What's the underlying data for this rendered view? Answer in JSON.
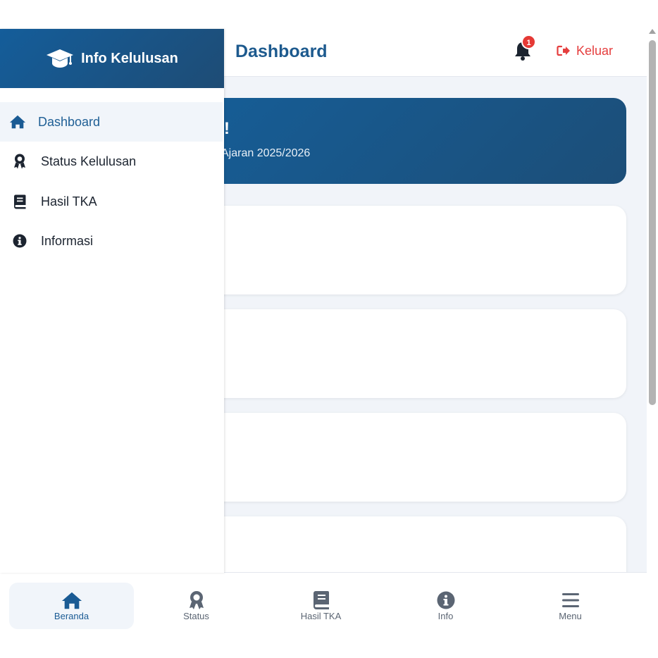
{
  "header": {
    "page_title": "Dashboard",
    "notification_count": "1",
    "logout_label": "Keluar"
  },
  "welcome": {
    "title_visible": "!",
    "subtitle_visible": "Ajaran 2025/2026"
  },
  "sidebar": {
    "brand": "Info Kelulusan",
    "items": [
      {
        "label": "Dashboard",
        "icon": "home-icon",
        "active": true
      },
      {
        "label": "Status Kelulusan",
        "icon": "award-icon",
        "active": false
      },
      {
        "label": "Hasil TKA",
        "icon": "book-icon",
        "active": false
      },
      {
        "label": "Informasi",
        "icon": "info-icon",
        "active": false
      }
    ]
  },
  "bottom_nav": {
    "items": [
      {
        "label": "Beranda",
        "icon": "home-icon",
        "active": true
      },
      {
        "label": "Status",
        "icon": "award-icon",
        "active": false
      },
      {
        "label": "Hasil TKA",
        "icon": "book-icon",
        "active": false
      },
      {
        "label": "Info",
        "icon": "info-icon",
        "active": false
      },
      {
        "label": "Menu",
        "icon": "menu-icon",
        "active": false
      }
    ]
  },
  "colors": {
    "primary": "#1a5b94",
    "danger": "#e53e3e",
    "background": "#f1f4f9"
  }
}
